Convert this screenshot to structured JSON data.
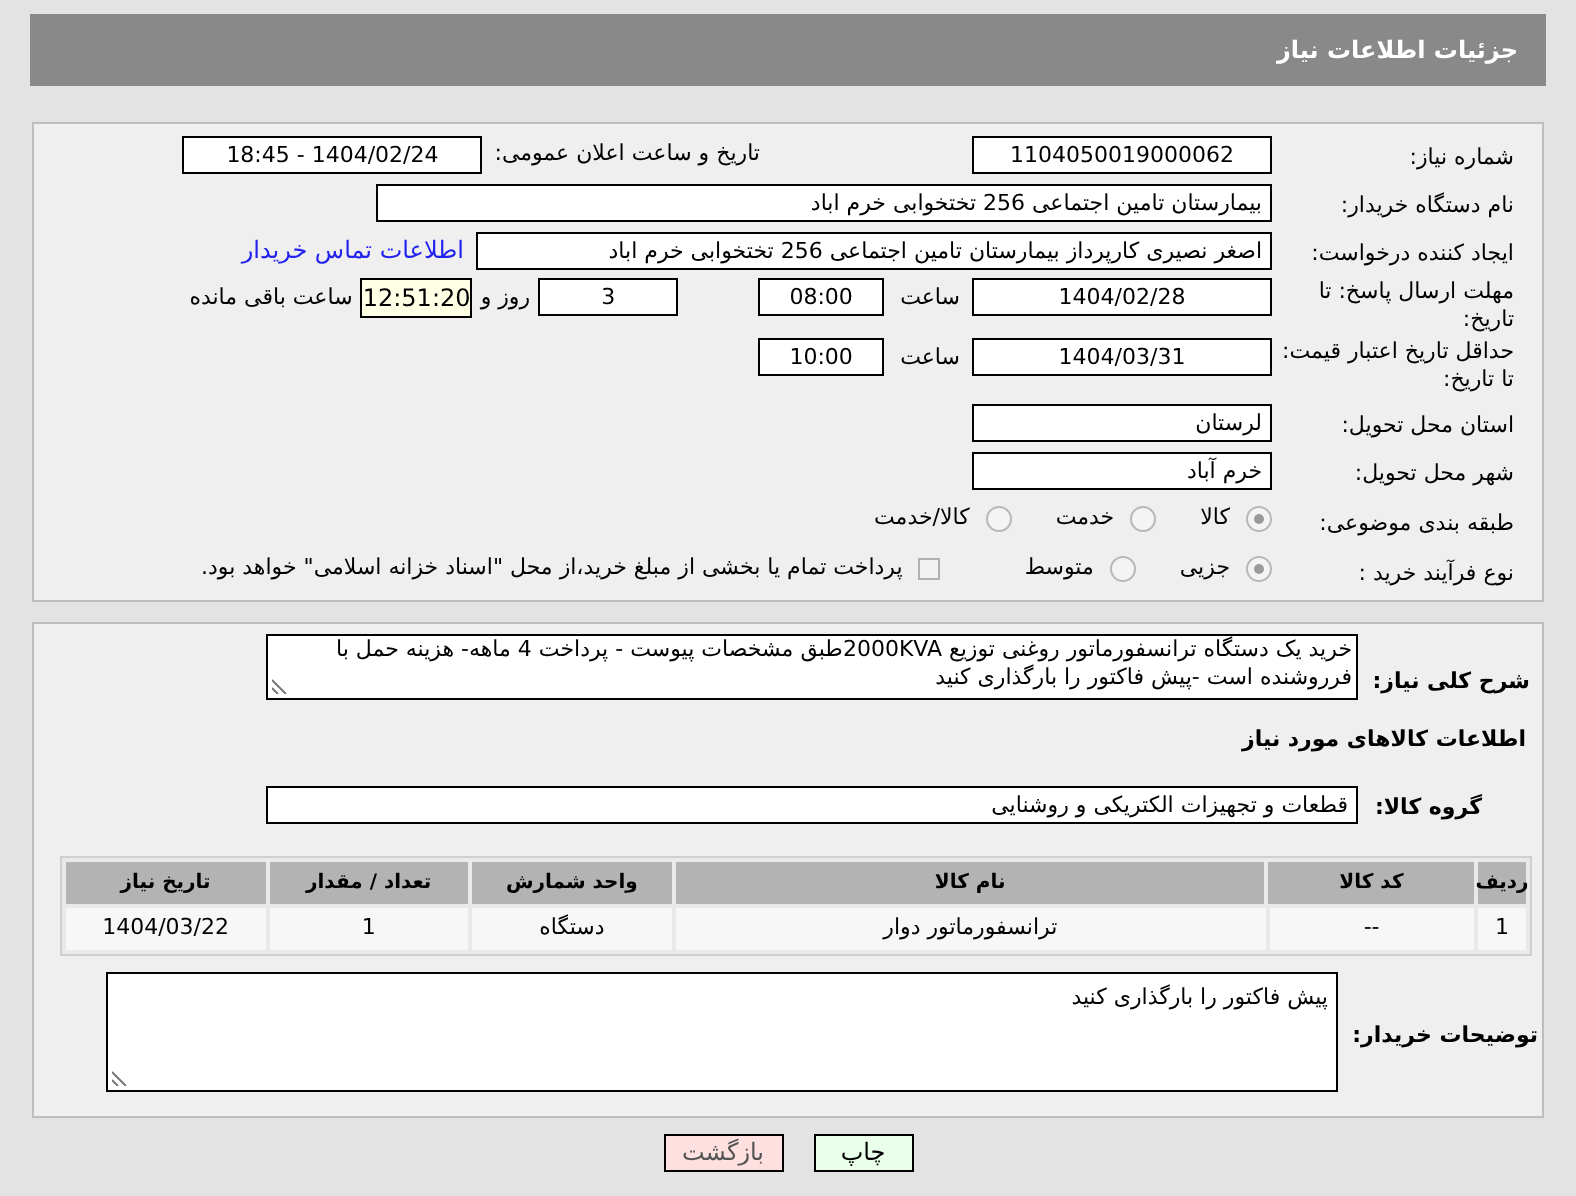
{
  "header": {
    "title": "جزئیات اطلاعات نیاز"
  },
  "need_number": {
    "label": "شماره نیاز:",
    "value": "1104050019000062"
  },
  "announce": {
    "label": "تاریخ و ساعت اعلان عمومی:",
    "value": "1404/02/24 - 18:45"
  },
  "buyer_org": {
    "label": "نام دستگاه خریدار:",
    "value": "بیمارستان تامین اجتماعی  256 تختخوابی خرم اباد"
  },
  "requester": {
    "label": "ایجاد کننده درخواست:",
    "value": "اصغر نصیری کارپرداز بیمارستان تامین اجتماعی  256 تختخوابی خرم اباد",
    "link": "اطلاعات تماس خریدار"
  },
  "deadline": {
    "label": "مهلت ارسال پاسخ: تا تاریخ:",
    "date": "1404/02/28",
    "time_label": "ساعت",
    "time": "08:00",
    "days": "3",
    "days_label": "روز و",
    "remaining": "12:51:20",
    "remaining_label": "ساعت باقی مانده"
  },
  "validity": {
    "label": "حداقل تاریخ اعتبار قیمت: تا تاریخ:",
    "date": "1404/03/31",
    "time_label": "ساعت",
    "time": "10:00"
  },
  "province": {
    "label": "استان محل تحویل:",
    "value": "لرستان"
  },
  "city": {
    "label": "شهر محل تحویل:",
    "value": "خرم آباد"
  },
  "category": {
    "label": "طبقه بندی موضوعی:",
    "options": [
      {
        "label": "کالا",
        "selected": true
      },
      {
        "label": "خدمت",
        "selected": false
      },
      {
        "label": "کالا/خدمت",
        "selected": false
      }
    ]
  },
  "process": {
    "label": "نوع فرآیند خرید :",
    "options": [
      {
        "label": "جزیی",
        "selected": true
      },
      {
        "label": "متوسط",
        "selected": false
      }
    ],
    "payment": {
      "label": "پرداخت تمام یا بخشی از مبلغ خرید،از محل \"اسناد خزانه اسلامی\" خواهد بود.",
      "checked": false
    }
  },
  "description": {
    "label": "شرح کلی نیاز:",
    "value": "خرید یک دستگاه ترانسفورماتور روغنی توزیع 2000KVAطبق مشخصات پیوست - پرداخت 4 ماهه- هزینه حمل با فرروشنده است -پیش فاکتور را بارگذاری کنید"
  },
  "goods_title": "اطلاعات کالاهای مورد نیاز",
  "group": {
    "label": "گروه کالا:",
    "value": "قطعات و تجهیزات الکتریکی و روشنایی"
  },
  "table": {
    "columns": [
      "ردیف",
      "کد کالا",
      "نام کالا",
      "واحد شمارش",
      "تعداد / مقدار",
      "تاریخ نیاز"
    ],
    "rows": [
      [
        "1",
        "--",
        "ترانسفورماتور دوار",
        "دستگاه",
        "1",
        "1404/03/22"
      ]
    ]
  },
  "buyer_notes": {
    "label": "توضیحات خریدار:",
    "value": "پیش فاکتور را بارگذاری کنید"
  },
  "buttons": [
    {
      "label": "چاپ",
      "kind": "print"
    },
    {
      "label": "بازگشت",
      "kind": "back"
    }
  ]
}
